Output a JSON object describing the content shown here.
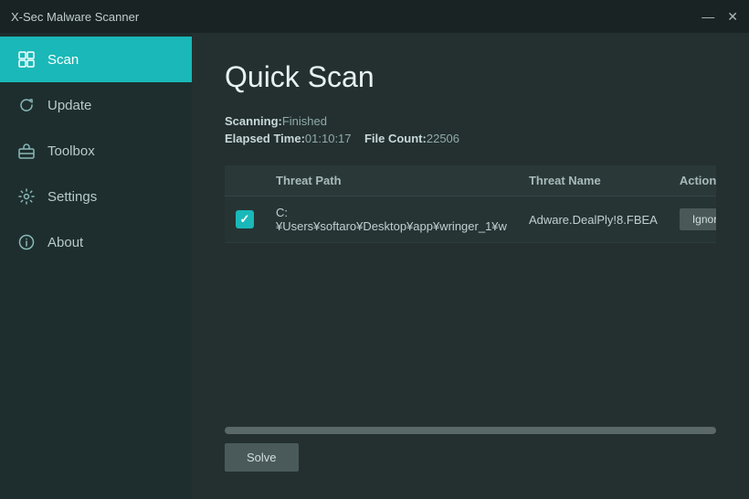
{
  "titleBar": {
    "title": "X-Sec Malware Scanner",
    "minimizeLabel": "—",
    "closeLabel": "✕"
  },
  "sidebar": {
    "items": [
      {
        "id": "scan",
        "label": "Scan",
        "active": true
      },
      {
        "id": "update",
        "label": "Update",
        "active": false
      },
      {
        "id": "toolbox",
        "label": "Toolbox",
        "active": false
      },
      {
        "id": "settings",
        "label": "Settings",
        "active": false
      },
      {
        "id": "about",
        "label": "About",
        "active": false
      }
    ]
  },
  "content": {
    "pageTitle": "Quick Scan",
    "scanningLabel": "Scanning:",
    "scanningStatus": "Finished",
    "elapsedLabel": "Elapsed Time:",
    "elapsedValue": "01:10:17",
    "fileCountLabel": "File Count:",
    "fileCountValue": "22506",
    "table": {
      "columns": [
        {
          "id": "checkbox",
          "label": ""
        },
        {
          "id": "threatPath",
          "label": "Threat Path"
        },
        {
          "id": "threatName",
          "label": "Threat Name"
        },
        {
          "id": "action",
          "label": "Action"
        }
      ],
      "rows": [
        {
          "checked": true,
          "threatPath": "C:¥Users¥softaro¥Desktop¥app¥wringer_1¥w",
          "threatName": "Adware.DealPly!8.FBEA",
          "actionLabel": "Ignore"
        }
      ]
    },
    "progressPercent": 100,
    "solveButtonLabel": "Solve"
  }
}
